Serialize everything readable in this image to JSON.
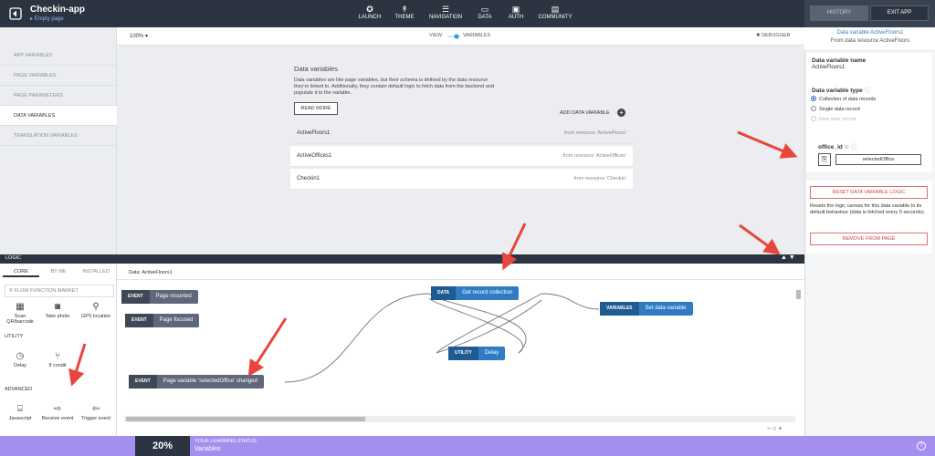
{
  "app": {
    "title": "Checkin-app",
    "subtitle": "Empty page"
  },
  "nav": [
    {
      "label": "LAUNCH",
      "icon": "rocket-icon"
    },
    {
      "label": "THEME",
      "icon": "brush-icon"
    },
    {
      "label": "NAVIGATION",
      "icon": "list-icon"
    },
    {
      "label": "DATA",
      "icon": "folder-icon"
    },
    {
      "label": "AUTH",
      "icon": "lock-icon"
    },
    {
      "label": "COMMUNITY",
      "icon": "chat-icon"
    }
  ],
  "header_right": {
    "history": "HISTORY",
    "exit": "EXIT APP"
  },
  "sidebar": {
    "items": [
      {
        "label": "APP VARIABLES"
      },
      {
        "label": "PAGE VARIABLES"
      },
      {
        "label": "PAGE PARAMETERS"
      },
      {
        "label": "DATA VARIABLES"
      },
      {
        "label": "TRANSLATION VARIABLES"
      }
    ]
  },
  "toolbar": {
    "zoom": "100% ▾",
    "view": "VIEW",
    "variables": "VARIABLES",
    "debugger": "DEBUGGER"
  },
  "main": {
    "title": "Data variables",
    "description": "Data variables are like page variables, but their schema is defined by the data resource they're linked to. Additionally, they contain default logic to fetch data from the backend and populate it to the variable.",
    "read_more": "READ MORE",
    "add": "ADD DATA VARIABLE",
    "rows": [
      {
        "name": "ActiveFloors1",
        "resource": "from resource 'ActiveFloors'"
      },
      {
        "name": "ActiveOffices1",
        "resource": "from resource 'ActiveOffices'"
      },
      {
        "name": "Checkin1",
        "resource": "from resource 'Checkin'"
      }
    ]
  },
  "right_panel": {
    "title": "Data variable ActiveFloors1",
    "subtitle": "From data resource ActiveFloors",
    "name_label": "Data variable name",
    "name_value": "ActiveFloors1",
    "type_label": "Data variable type",
    "types": [
      "Collection of data records",
      "Single data record",
      "New data record"
    ],
    "param_label": "office_id",
    "param_value": "selectedOffice",
    "reset": "RESET DATA VARIABLE LOGIC",
    "reset_desc": "Resets the logic canvas for this data variable to its default behaviour (data is fetched every 5 seconds).",
    "remove": "REMOVE FROM PAGE"
  },
  "logic": {
    "label": "LOGIC",
    "tabs": [
      "CORE",
      "BY ME",
      "INSTALLED"
    ],
    "search_placeholder": "FLOW FUNCTION MARKET",
    "canvas_title": "Data: ActiveFloors1",
    "palette_top": [
      {
        "label": "Scan QR/barcode",
        "icon": "qr-icon"
      },
      {
        "label": "Take photo",
        "icon": "camera-icon"
      },
      {
        "label": "GPS location",
        "icon": "location-icon"
      }
    ],
    "utility_label": "UTILITY",
    "palette_utility": [
      {
        "label": "Delay",
        "icon": "clock-icon"
      },
      {
        "label": "If condit",
        "icon": "branch-icon"
      }
    ],
    "advanced_label": "ADVANCED",
    "palette_advanced": [
      {
        "label": "Javascript",
        "icon": "script-icon"
      },
      {
        "label": "Receive event",
        "icon": "arrow-in-icon"
      },
      {
        "label": "Trigger event",
        "icon": "arrow-out-icon"
      }
    ],
    "nodes": {
      "page_mounted": {
        "tag": "EVENT",
        "label": "Page mounted"
      },
      "page_focused": {
        "tag": "EVENT",
        "label": "Page focused"
      },
      "var_changed": {
        "tag": "EVENT",
        "label": "Page variable 'selectedOffice' changed"
      },
      "get_record": {
        "tag": "DATA",
        "label": "Get record collection"
      },
      "delay": {
        "tag": "UTILITY",
        "label": "Delay"
      },
      "set_var": {
        "tag": "VARIABLES",
        "label": "Set data variable"
      }
    },
    "zoom_controls": "− ○ +"
  },
  "learning": {
    "percent": "20%",
    "label": "YOUR LEARNING STATUS",
    "value": "Variables"
  },
  "colors": {
    "topbar": "#2b3440",
    "accent": "#2f7cc4",
    "learning_bar": "#a48ef0",
    "arrow": "#e8453c"
  }
}
